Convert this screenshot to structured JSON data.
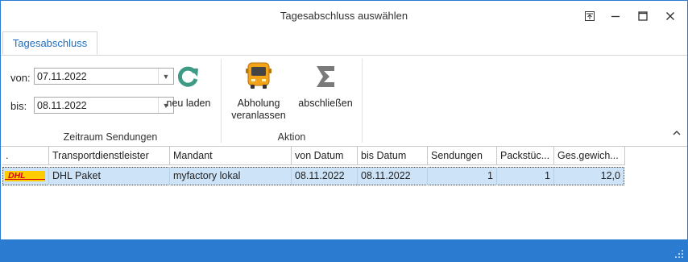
{
  "window": {
    "title": "Tagesabschluss auswählen"
  },
  "tabs": [
    {
      "label": "Tagesabschluss"
    }
  ],
  "ribbon": {
    "from_label": "von:",
    "from_value": "07.11.2022",
    "to_label": "bis:",
    "to_value": "08.11.2022",
    "reload_label": "neu laden",
    "group1_label": "Zeitraum Sendungen",
    "pickup_label": "Abholung veranlassen",
    "close_label": "abschließen",
    "group2_label": "Aktion"
  },
  "grid": {
    "columns": [
      ".",
      "Transportdienstleister",
      "Mandant",
      "von Datum",
      "bis Datum",
      "Sendungen",
      "Packstüc...",
      "Ges.gewich..."
    ],
    "rows": [
      {
        "logo": "DHL",
        "carrier": "DHL Paket",
        "client": "myfactory lokal",
        "from": "08.11.2022",
        "to": "08.11.2022",
        "shipments": "1",
        "packages": "1",
        "weight": "12,0"
      }
    ]
  },
  "colors": {
    "accent": "#2b7bd0",
    "selection": "#cde3f7",
    "dhl_yellow": "#ffcc00",
    "dhl_red": "#d40511"
  }
}
